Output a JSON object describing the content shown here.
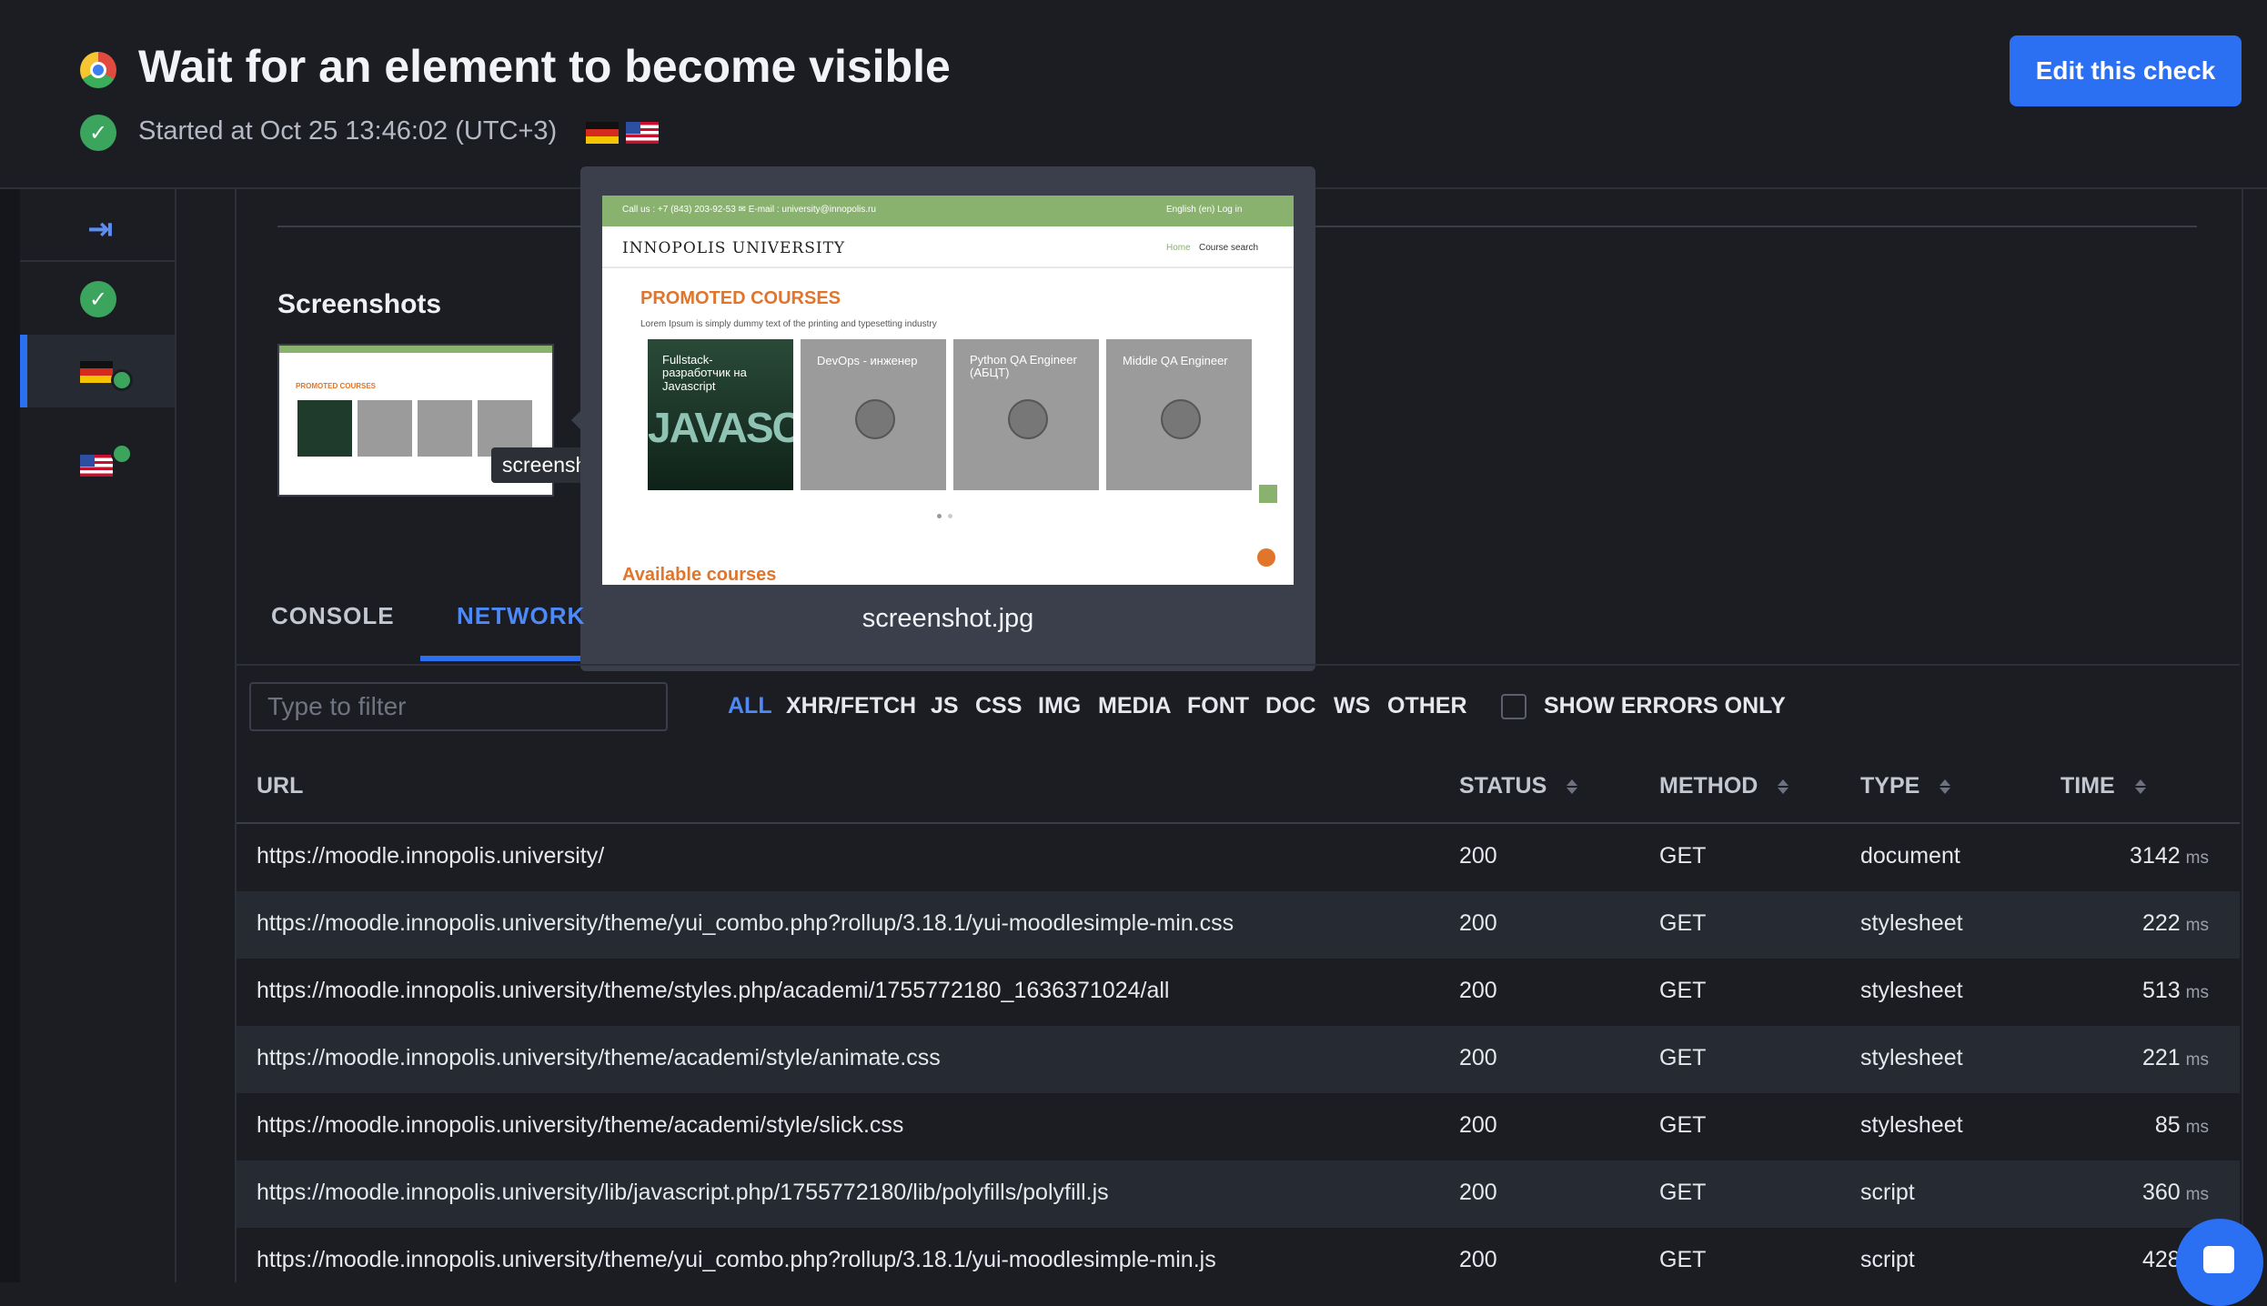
{
  "header": {
    "title": "Wait for an element to become visible",
    "started": "Started at Oct 25 13:46:02 (UTC+3)",
    "edit_button": "Edit this check"
  },
  "screenshots": {
    "heading": "Screenshots",
    "tooltip": "screenshot.jpg",
    "caption": "screenshot.jpg",
    "preview": {
      "topbar_left": "Call us : +7 (843) 203-92-53  ✉ E-mail : university@innopolis.ru",
      "topbar_right": "English (en)  Log in",
      "logo": "INNOPOLIS UNIVERSITY",
      "nav": [
        "Home",
        "Course search"
      ],
      "promoted": "PROMOTED COURSES",
      "lorem": "Lorem Ipsum is simply dummy text of the printing and typesetting industry",
      "cards": [
        "Fullstack-разработчик на Javascript",
        "DevOps - инженер",
        "Python QA Engineer (АБЦТ)",
        "Middle QA Engineer"
      ],
      "js_word": "JAVASCRI",
      "available": "Available courses"
    }
  },
  "tabs": [
    "CONSOLE",
    "NETWORK"
  ],
  "filter": {
    "placeholder": "Type to filter",
    "types": [
      "ALL",
      "XHR/FETCH",
      "JS",
      "CSS",
      "IMG",
      "MEDIA",
      "FONT",
      "DOC",
      "WS",
      "OTHER"
    ],
    "errors_label": "SHOW ERRORS ONLY"
  },
  "table": {
    "headers": [
      "URL",
      "STATUS",
      "METHOD",
      "TYPE",
      "TIME"
    ],
    "unit": "ms",
    "rows": [
      {
        "url": "https://moodle.innopolis.university/",
        "status": "200",
        "method": "GET",
        "type": "document",
        "time": "3142"
      },
      {
        "url": "https://moodle.innopolis.university/theme/yui_combo.php?rollup/3.18.1/yui-moodlesimple-min.css",
        "status": "200",
        "method": "GET",
        "type": "stylesheet",
        "time": "222"
      },
      {
        "url": "https://moodle.innopolis.university/theme/styles.php/academi/1755772180_1636371024/all",
        "status": "200",
        "method": "GET",
        "type": "stylesheet",
        "time": "513"
      },
      {
        "url": "https://moodle.innopolis.university/theme/academi/style/animate.css",
        "status": "200",
        "method": "GET",
        "type": "stylesheet",
        "time": "221"
      },
      {
        "url": "https://moodle.innopolis.university/theme/academi/style/slick.css",
        "status": "200",
        "method": "GET",
        "type": "stylesheet",
        "time": "85"
      },
      {
        "url": "https://moodle.innopolis.university/lib/javascript.php/1755772180/lib/polyfills/polyfill.js",
        "status": "200",
        "method": "GET",
        "type": "script",
        "time": "360"
      },
      {
        "url": "https://moodle.innopolis.university/theme/yui_combo.php?rollup/3.18.1/yui-moodlesimple-min.js",
        "status": "200",
        "method": "GET",
        "type": "script",
        "time": "428"
      }
    ]
  }
}
